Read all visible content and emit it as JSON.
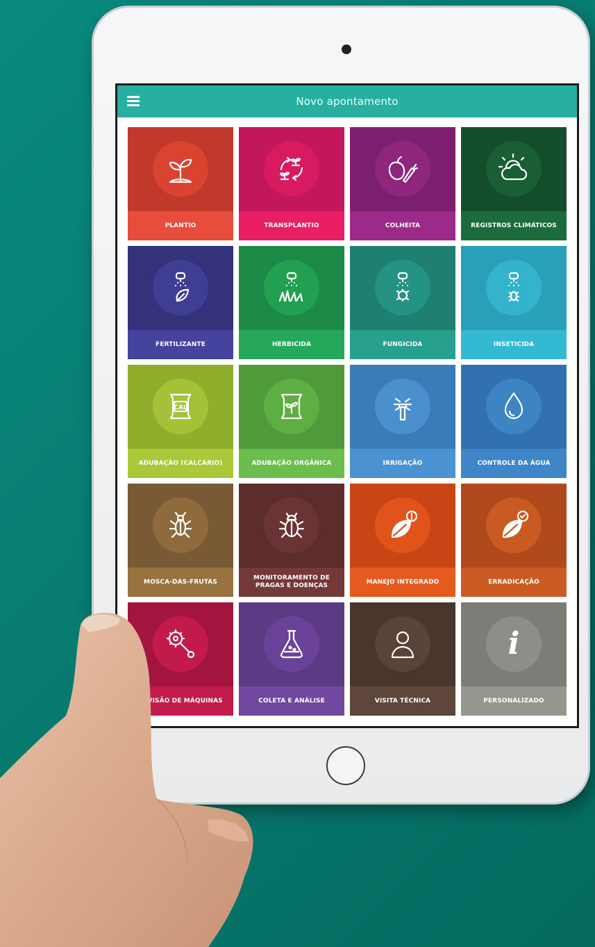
{
  "app": {
    "title": "Novo apontamento",
    "bar_color": "#27b0a0"
  },
  "tiles": [
    {
      "label": "PLANTIO",
      "icon": "seedling-icon",
      "top": "#c0392b",
      "bottom": "#e74c3c",
      "circle": "#d9432f"
    },
    {
      "label": "TRANSPLANTIO",
      "icon": "transplant-cycle-icon",
      "top": "#c2185b",
      "bottom": "#e91e63",
      "circle": "#d81b60"
    },
    {
      "label": "COLHEITA",
      "icon": "fruit-vegetable-icon",
      "top": "#7b1f6e",
      "bottom": "#9c2a8a",
      "circle": "#8e267e"
    },
    {
      "label": "REGISTROS CLIMÁTICOS",
      "icon": "sun-cloud-icon",
      "top": "#134d2c",
      "bottom": "#1b6b3c",
      "circle": "#1a5e36"
    },
    {
      "label": "FERTILIZANTE",
      "icon": "sprayer-leaf-icon",
      "top": "#34327a",
      "bottom": "#45439e",
      "circle": "#403e92"
    },
    {
      "label": "HERBICIDA",
      "icon": "sprayer-grass-icon",
      "top": "#1d8a47",
      "bottom": "#25a85a",
      "circle": "#22a052"
    },
    {
      "label": "FUNGICIDA",
      "icon": "sprayer-fungus-icon",
      "top": "#1f8072",
      "bottom": "#27a090",
      "circle": "#249383"
    },
    {
      "label": "INSETICIDA",
      "icon": "sprayer-insect-icon",
      "top": "#2aa0b8",
      "bottom": "#34b9d2",
      "circle": "#33b3cc"
    },
    {
      "label": "ADUBAÇÃO (CALCÁRIO)",
      "icon": "lime-sack-icon",
      "top": "#8fae2c",
      "bottom": "#a9c93a",
      "circle": "#a3c237"
    },
    {
      "label": "ADUBAÇÃO ORGÂNICA",
      "icon": "organic-sack-icon",
      "top": "#4f9a3a",
      "bottom": "#6bbd4d",
      "circle": "#5daf44"
    },
    {
      "label": "IRRIGAÇÃO",
      "icon": "sprinkler-icon",
      "top": "#3a7cb8",
      "bottom": "#4b92d2",
      "circle": "#4a90cc"
    },
    {
      "label": "CONTROLE DA ÁGUA",
      "icon": "water-drop-icon",
      "top": "#3171b0",
      "bottom": "#3f86c9",
      "circle": "#3d84c5"
    },
    {
      "label": "MOSCA-DAS-FRUTAS",
      "icon": "fly-icon",
      "top": "#7a5a34",
      "bottom": "#98733f",
      "circle": "#8f6a3d"
    },
    {
      "label": "MONITORAMENTO DE\nPRAGAS E DOENÇAS",
      "icon": "beetle-icon",
      "top": "#5d2c2c",
      "bottom": "#743838",
      "circle": "#6b3434"
    },
    {
      "label": "MANEJO INTEGRADO",
      "icon": "leaf-alert-icon",
      "top": "#c94516",
      "bottom": "#e55a1f",
      "circle": "#e0531b"
    },
    {
      "label": "ERRADICAÇÃO",
      "icon": "leaf-check-icon",
      "top": "#b04a1c",
      "bottom": "#cc5a23",
      "circle": "#c95a22"
    },
    {
      "label": "REVISÃO DE MÁQUINAS",
      "icon": "wrench-gear-icon",
      "top": "#a3153f",
      "bottom": "#c21c4c",
      "circle": "#c21b4b"
    },
    {
      "label": "COLETA E ANÁLISE",
      "icon": "flask-icon",
      "top": "#5c3a84",
      "bottom": "#7048a0",
      "circle": "#6a4398"
    },
    {
      "label": "VISITA TÉCNICA",
      "icon": "person-icon",
      "top": "#4a362c",
      "bottom": "#5e463a",
      "circle": "#5a4338"
    },
    {
      "label": "PERSONALIZADO",
      "icon": "info-icon",
      "top": "#7d7d78",
      "bottom": "#96968f",
      "circle": "#8e8e88"
    }
  ],
  "info_glyph": "i"
}
